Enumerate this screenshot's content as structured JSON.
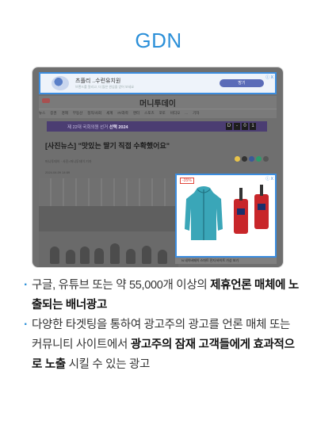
{
  "heading": "GDN",
  "screenshot": {
    "top_ad": {
      "name": "츠플리 ..수련유치원",
      "sub": "브랜드를 알리고, 더 많은 관심을 얻어 보세요",
      "button": "방기",
      "close": "ⓘ X"
    },
    "site_logo": "머니투데이",
    "nav_items": [
      "뉴스",
      "증권",
      "경제",
      "부동산",
      "정치/사회",
      "세계",
      "IT/과학",
      "엔터",
      "스포츠",
      "포토",
      "비디오",
      "...",
      "기자"
    ],
    "election_banner": {
      "text": "제 22대 국회의원 선거",
      "highlight": "선택 2024",
      "dday": [
        "D",
        "-",
        "0",
        "1"
      ]
    },
    "headline": "[사진뉴스] \"맛있는 딸기 직접 수확했어요\"",
    "byline": "머니투데이 · 사진=머니투데이 기자",
    "date": "2024.04.09 14:59",
    "product_ad": {
      "sale": "-35%",
      "close": "ⓘ X",
      "footer": "N 네이버페이 스마트 전자 바이트 가상 보기"
    },
    "social_colors": [
      "#e8c34a",
      "#333333",
      "#3b5998",
      "#2d9a6a",
      "#555555"
    ]
  },
  "bullets": [
    {
      "parts": [
        {
          "t": "구글, 유튜브 또는 약 55,000개 이상의 ",
          "b": false
        },
        {
          "t": "제휴언론 매체에 노출되는 배너광고",
          "b": true
        }
      ]
    },
    {
      "parts": [
        {
          "t": "다양한 타겟팅을 통하여 광고주의 광고를 언론 매체 또는 커뮤니티 사이트에서 ",
          "b": false
        },
        {
          "t": "광고주의 잠재 고객들에게 효과적으로 노출",
          "b": true
        },
        {
          "t": " 시킬 수 있는 광고",
          "b": false
        }
      ]
    }
  ],
  "colors": {
    "heading": "#2b8fd8",
    "ad_border": "#3b8de0",
    "election": "#4b3d72"
  }
}
